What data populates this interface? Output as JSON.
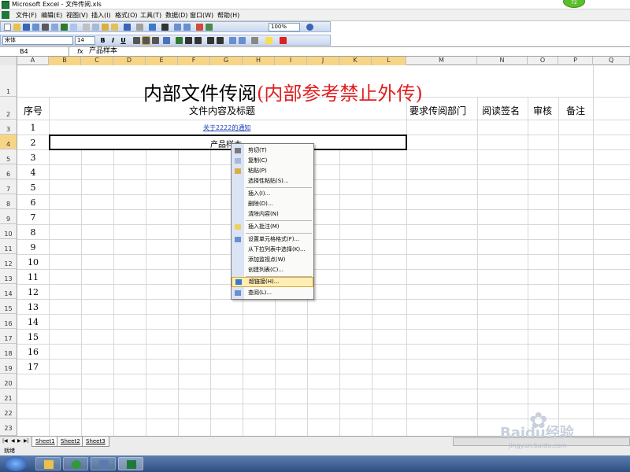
{
  "window": {
    "title": "Microsoft Excel - 文件传阅.xls",
    "badge": "72"
  },
  "menu": [
    "文件(F)",
    "编辑(E)",
    "视图(V)",
    "插入(I)",
    "格式(O)",
    "工具(T)",
    "数据(D)",
    "窗口(W)",
    "帮助(H)"
  ],
  "toolbar": {
    "zoom": "100%",
    "font_name": "宋体",
    "font_size": "14",
    "bold": "B",
    "italic": "I",
    "underline": "U"
  },
  "formula_bar": {
    "cell_ref": "B4",
    "fx": "fx",
    "value": "产品样本"
  },
  "columns": [
    "A",
    "B",
    "C",
    "D",
    "E",
    "F",
    "G",
    "H",
    "I",
    "J",
    "K",
    "L",
    "M",
    "N",
    "O",
    "P",
    "Q"
  ],
  "rows": [
    "1",
    "2",
    "3",
    "4",
    "5",
    "6",
    "7",
    "8",
    "9",
    "10",
    "11",
    "12",
    "13",
    "14",
    "15",
    "16",
    "17",
    "18",
    "19",
    "20",
    "21",
    "22",
    "23"
  ],
  "sheet": {
    "title_black": "内部文件传阅",
    "title_red": "(内部参考禁止外传)",
    "header_seq": "序号",
    "header_content": "文件内容及标题",
    "header_dept": "要求传阅部门",
    "header_sign": "阅读签名",
    "header_review": "审核",
    "header_note": "备注",
    "seq_numbers": [
      "1",
      "2",
      "3",
      "4",
      "5",
      "6",
      "7",
      "8",
      "9",
      "10",
      "11",
      "12",
      "13",
      "14",
      "15",
      "16",
      "17"
    ],
    "row3_link": "关于2222的通知",
    "row4_text": "产品样本"
  },
  "context_menu": {
    "items": [
      "剪切(T)",
      "复制(C)",
      "粘贴(P)",
      "选择性粘贴(S)...",
      "插入(I)...",
      "删除(D)...",
      "清除内容(N)",
      "插入批注(M)",
      "设置单元格格式(F)...",
      "从下拉列表中选择(K)...",
      "添加监视点(W)",
      "创建列表(C)...",
      "超链接(H)...",
      "查阅(L)..."
    ],
    "highlighted": "超链接(H)..."
  },
  "tabs": [
    "Sheet1",
    "Sheet2",
    "Sheet3"
  ],
  "status": "就绪",
  "watermark": {
    "brand": "Baidu经验",
    "url": "jingyan.baidu.com"
  },
  "colors": {
    "title_red": "#e02020",
    "link_blue": "#1a3fb5",
    "menu_highlight": "#ffeeb4"
  }
}
